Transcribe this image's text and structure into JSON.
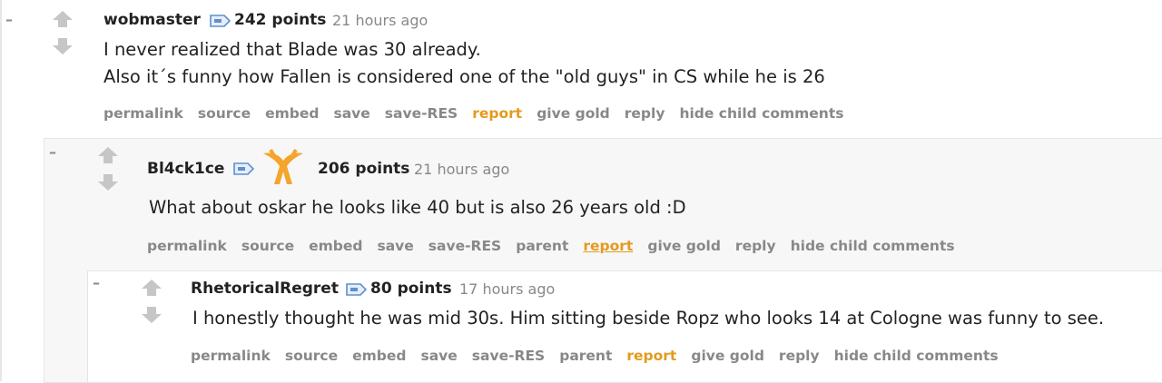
{
  "colors": {
    "report": "#e49a1e",
    "meta": "#888888",
    "text": "#222222",
    "nest_bg": "#f7f7f8"
  },
  "comments": [
    {
      "author": "wobmaster",
      "points": "242 points",
      "time": "21 hours ago",
      "lines": [
        "I never realized that Blade was 30 already.",
        "Also it´s funny how Fallen is considered one of the \"old guys\" in CS while he is 26"
      ],
      "actions": [
        "permalink",
        "source",
        "embed",
        "save",
        "save-RES",
        "report",
        "give gold",
        "reply",
        "hide child comments"
      ]
    },
    {
      "author": "Bl4ck1ce",
      "flair_icon": "fnatic-logo-icon",
      "points": "206 points",
      "time": "21 hours ago",
      "lines": [
        "What about oskar he looks like 40 but is also 26 years old :D"
      ],
      "actions": [
        "permalink",
        "source",
        "embed",
        "save",
        "save-RES",
        "parent",
        "report",
        "give gold",
        "reply",
        "hide child comments"
      ]
    },
    {
      "author": "RhetoricalRegret",
      "points": "80 points",
      "time": "17 hours ago",
      "lines": [
        "I honestly thought he was mid 30s. Him sitting beside Ropz who looks 14 at Cologne was funny to see."
      ],
      "actions": [
        "permalink",
        "source",
        "embed",
        "save",
        "save-RES",
        "parent",
        "report",
        "give gold",
        "reply",
        "hide child comments"
      ]
    }
  ],
  "collapse_label": "–"
}
